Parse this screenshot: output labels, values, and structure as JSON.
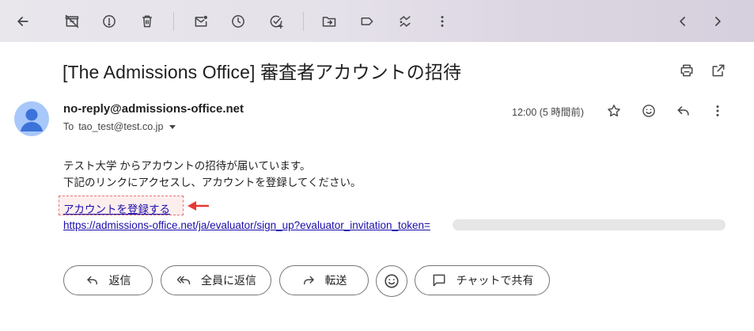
{
  "toolbar": {
    "icons": [
      "back-arrow-icon",
      "archive-off-icon",
      "report-spam-icon",
      "delete-icon",
      "mark-unread-icon",
      "snooze-icon",
      "add-task-icon",
      "move-to-icon",
      "label-icon",
      "more-actions-icon",
      "more-vert-icon",
      "prev-icon",
      "next-icon"
    ]
  },
  "email": {
    "subject": "[The Admissions Office] 審査者アカウントの招待",
    "sender": "no-reply@admissions-office.net",
    "to_label": "To",
    "recipient": "tao_test@test.co.jp",
    "time": "12:00 (5 時間前)",
    "body_line1": "テスト大学 からアカウントの招待が届いています。",
    "body_line2": "下記のリンクにアクセスし、アカウントを登録してください。",
    "register_link": "アカウントを登録する",
    "url": "https://admissions-office.net/ja/evaluator/sign_up?evaluator_invitation_token="
  },
  "actions": {
    "reply": "返信",
    "reply_all": "全員に返信",
    "forward": "転送",
    "chat_share": "チャットで共有"
  },
  "colors": {
    "link": "#1a0dab",
    "annotation_red": "#e53935",
    "avatar": "#a8c7fa"
  }
}
